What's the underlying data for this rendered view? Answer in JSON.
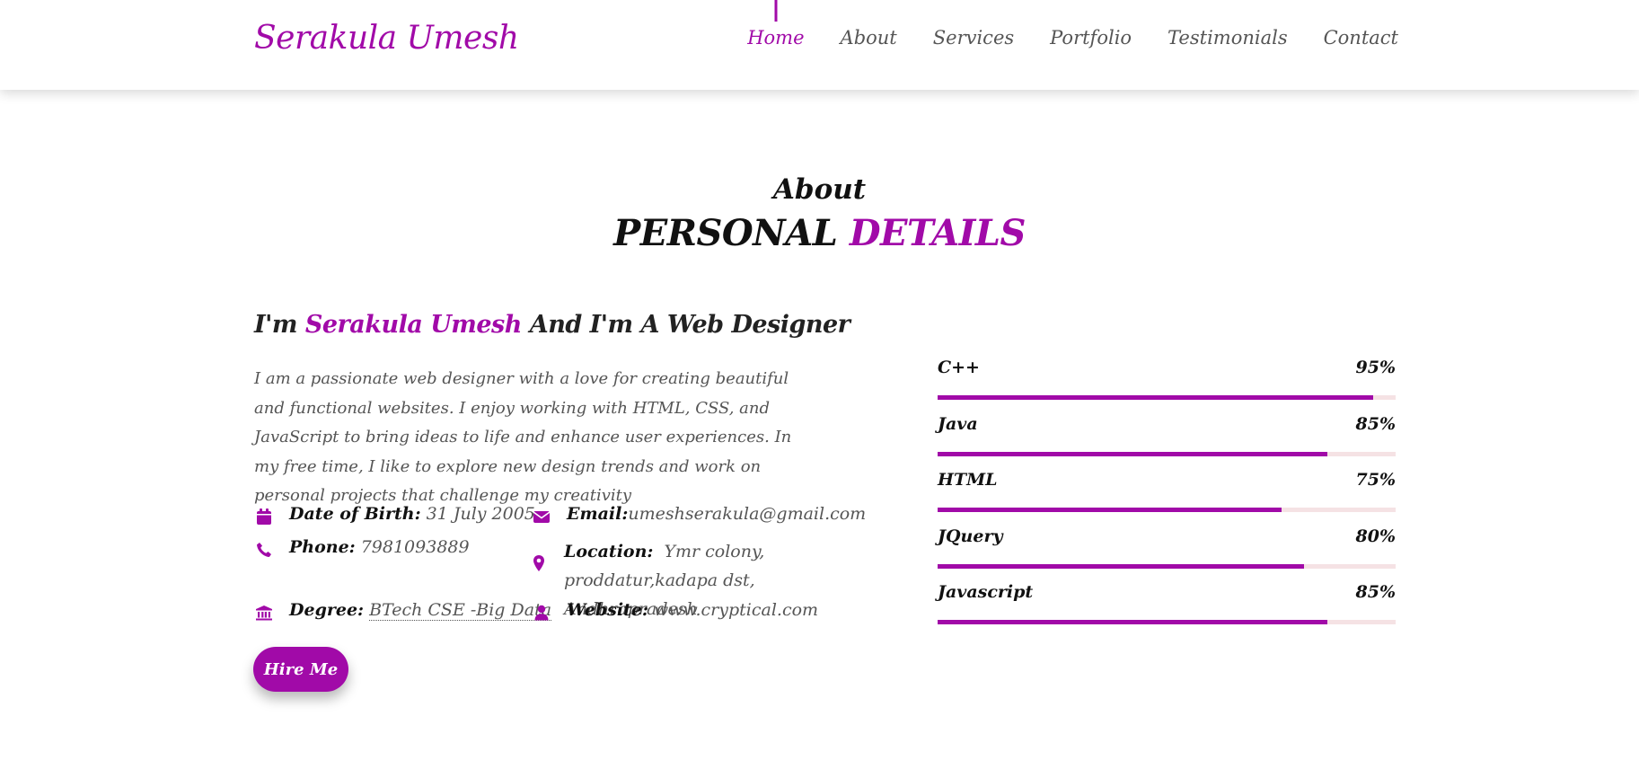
{
  "brand": "Serakula Umesh",
  "nav": [
    {
      "label": "Home",
      "active": true
    },
    {
      "label": "About",
      "active": false
    },
    {
      "label": "Services",
      "active": false
    },
    {
      "label": "Portfolio",
      "active": false
    },
    {
      "label": "Testimonials",
      "active": false
    },
    {
      "label": "Contact",
      "active": false
    }
  ],
  "section": {
    "subtitle": "About",
    "title_main": "PERSONAL",
    "title_accent": "DETAILS"
  },
  "intro": {
    "prefix": "I'm",
    "name": "Serakula Umesh",
    "suffix": "And I'm A Web Designer"
  },
  "bio": "I am a passionate web designer with a love for creating beautiful and functional websites. I enjoy working with HTML, CSS, and JavaScript to bring ideas to life and enhance user experiences. In my free time, I like to explore new design trends and work on personal projects that challenge my creativity",
  "info": {
    "dob": {
      "label": "Date of Birth:",
      "value": "31 July 2005",
      "icon": "calendar-icon"
    },
    "email": {
      "label": "Email:",
      "value": "umeshserakula@gmail.com",
      "icon": "envelope-icon"
    },
    "phone": {
      "label": "Phone:",
      "value": "7981093889",
      "icon": "phone-icon"
    },
    "location": {
      "label": "Location:",
      "value": "Ymr colony, proddatur,kadapa dst, Andhrapradesh",
      "icon": "map-marker-icon"
    },
    "degree": {
      "label": "Degree:",
      "value": "BTech CSE -Big Data",
      "icon": "university-icon"
    },
    "website": {
      "label": "Website:",
      "value": "www.cryptical.com",
      "icon": "user-icon"
    }
  },
  "hire_button": "Hire Me",
  "skills": [
    {
      "name": "C++",
      "percent_label": "95%",
      "percent": 95
    },
    {
      "name": "Java",
      "percent_label": "85%",
      "percent": 85
    },
    {
      "name": "HTML",
      "percent_label": "75%",
      "percent": 75
    },
    {
      "name": "JQuery",
      "percent_label": "80%",
      "percent": 80
    },
    {
      "name": "Javascript",
      "percent_label": "85%",
      "percent": 85
    }
  ],
  "colors": {
    "accent": "#a10aa8",
    "track": "#f5e2e4"
  }
}
